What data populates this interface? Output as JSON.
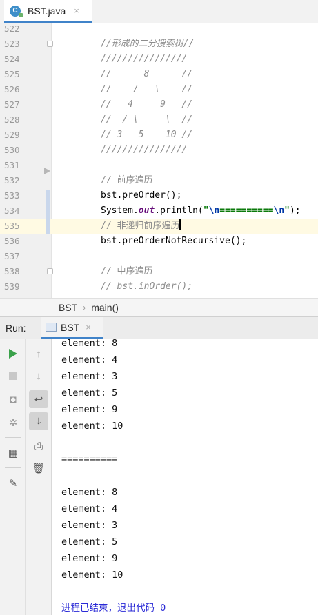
{
  "editor_tab": {
    "icon": "C",
    "label": "BST.java",
    "close": "×"
  },
  "editor": {
    "lines": [
      {
        "num": "522",
        "text": ""
      },
      {
        "num": "523",
        "text": "//形成的二分搜索树//",
        "style": "comment"
      },
      {
        "num": "524",
        "text": "////////////////",
        "style": "comment"
      },
      {
        "num": "525",
        "text": "//      8      //",
        "style": "comment"
      },
      {
        "num": "526",
        "text": "//    /   \\    //",
        "style": "comment"
      },
      {
        "num": "527",
        "text": "//   4     9   //",
        "style": "comment"
      },
      {
        "num": "528",
        "text": "//  / \\     \\  //",
        "style": "comment"
      },
      {
        "num": "529",
        "text": "// 3   5    10 //",
        "style": "comment"
      },
      {
        "num": "530",
        "text": "////////////////",
        "style": "comment"
      },
      {
        "num": "531",
        "text": ""
      },
      {
        "num": "532",
        "text": "// 前序遍历",
        "style": "comment-plain"
      },
      {
        "num": "533",
        "text": "bst.preOrder();"
      },
      {
        "num": "534",
        "parts": [
          "System.",
          "out",
          ".println(",
          "\"",
          "\\n",
          "==========",
          "\\n",
          "\"",
          ");"
        ]
      },
      {
        "num": "535",
        "text": "// 非递归前序遍历",
        "style": "comment-plain"
      },
      {
        "num": "536",
        "text": "bst.preOrderNotRecursive();"
      },
      {
        "num": "537",
        "text": ""
      },
      {
        "num": "538",
        "text": "// 中序遍历",
        "style": "comment-plain"
      },
      {
        "num": "539",
        "text": "// bst.inOrder();",
        "style": "comment"
      }
    ],
    "current_line": "535"
  },
  "breadcrumb": {
    "class_name": "BST",
    "separator": "›",
    "method": "main()"
  },
  "run_panel": {
    "label": "Run:",
    "tab_label": "BST",
    "tab_close": "×",
    "toolbar_left": [
      {
        "name": "run-icon",
        "glyph": ""
      },
      {
        "name": "stop-icon",
        "glyph": ""
      },
      {
        "name": "camera-icon",
        "glyph": "◘"
      },
      {
        "name": "bug-icon",
        "glyph": "✲"
      },
      {
        "name": "layout-icon",
        "glyph": "▦"
      },
      {
        "name": "pin-icon",
        "glyph": "✎"
      }
    ],
    "toolbar_right": [
      {
        "name": "up-arrow-icon",
        "glyph": "↑"
      },
      {
        "name": "down-arrow-icon",
        "glyph": "↓"
      },
      {
        "name": "soft-wrap-icon",
        "glyph": "↩"
      },
      {
        "name": "scroll-to-end-icon",
        "glyph": "⤓"
      },
      {
        "name": "print-icon",
        "glyph": "⎙"
      },
      {
        "name": "trash-icon",
        "glyph": "🗑"
      }
    ],
    "output": [
      "element: 8",
      "element: 4",
      "element: 3",
      "element: 5",
      "element: 9",
      "element: 10",
      "",
      "==========",
      "",
      "element: 8",
      "element: 4",
      "element: 3",
      "element: 5",
      "element: 9",
      "element: 10",
      "",
      "进程已结束，退出代码 0"
    ]
  }
}
